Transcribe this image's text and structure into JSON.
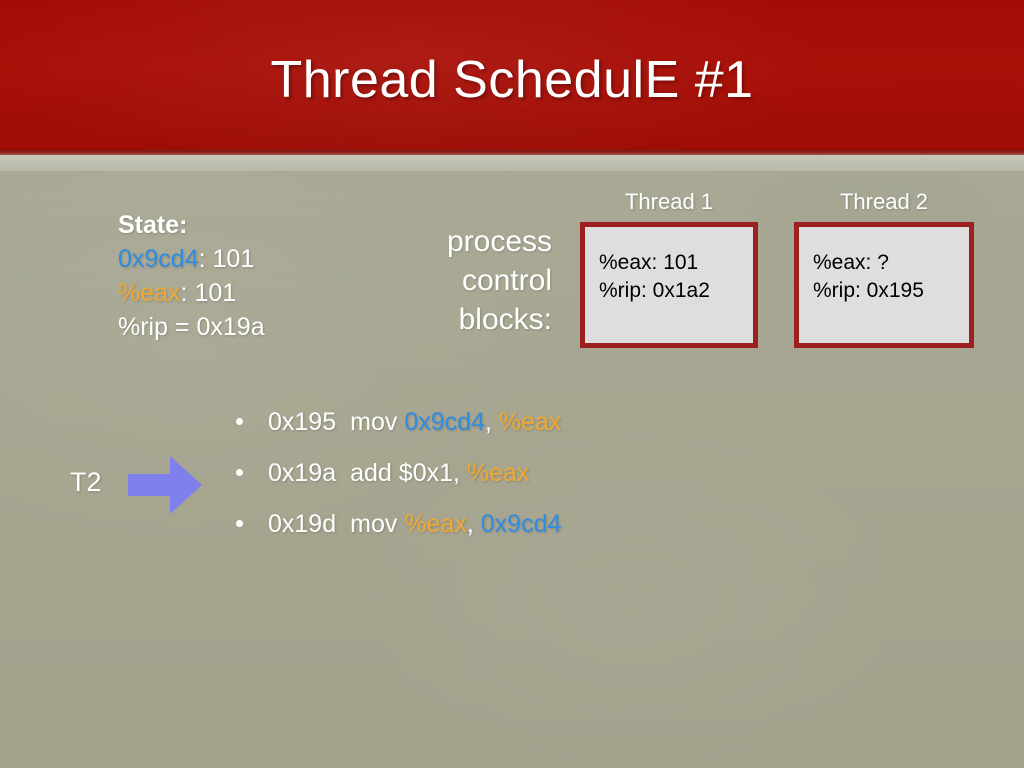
{
  "slide": {
    "title": "Thread SchedulE #1",
    "banner_color": "#a40d07",
    "background_color": "#a7a794"
  },
  "state": {
    "heading": "State:",
    "lines": [
      {
        "label": "0x9cd4",
        "label_color": "#2f8ce2",
        "rest": ": 101"
      },
      {
        "label": "%eax",
        "label_color": "#f0a832",
        "rest": ": 101"
      },
      {
        "label": "%rip = 0x19a",
        "label_color": "#ffffff",
        "rest": ""
      }
    ],
    "line1_label": "0x9cd4",
    "line1_rest": ": 101",
    "line2_label": "%eax",
    "line2_rest": ": 101",
    "line3": "%rip = 0x19a"
  },
  "pcb": {
    "line1": "process",
    "line2": "control",
    "line3": "blocks:"
  },
  "threads": [
    {
      "label": "Thread 1",
      "eax": "%eax: 101",
      "rip": "%rip: 0x1a2"
    },
    {
      "label": "Thread 2",
      "eax": "%eax: ?",
      "rip": "%rip: 0x195"
    }
  ],
  "marker": {
    "label": "T2",
    "arrow_color": "#8080ec",
    "arrow_name": "right-arrow"
  },
  "instructions": [
    {
      "address": "0x195",
      "mnemonic": "mov",
      "op1": "0x9cd4",
      "op1_color": "#2f8ce2",
      "separator": ",",
      "op2": "%eax",
      "op2_color": "#f0a832"
    },
    {
      "address": "0x19a",
      "mnemonic": "add",
      "op1": "$0x1",
      "op1_color": "#ffffff",
      "separator": ",",
      "op2": "%eax",
      "op2_color": "#f0a832"
    },
    {
      "address": "0x19d",
      "mnemonic": "mov",
      "op1": "%eax",
      "op1_color": "#f0a832",
      "separator": ",",
      "op2": "0x9cd4",
      "op2_color": "#2f8ce2"
    }
  ]
}
